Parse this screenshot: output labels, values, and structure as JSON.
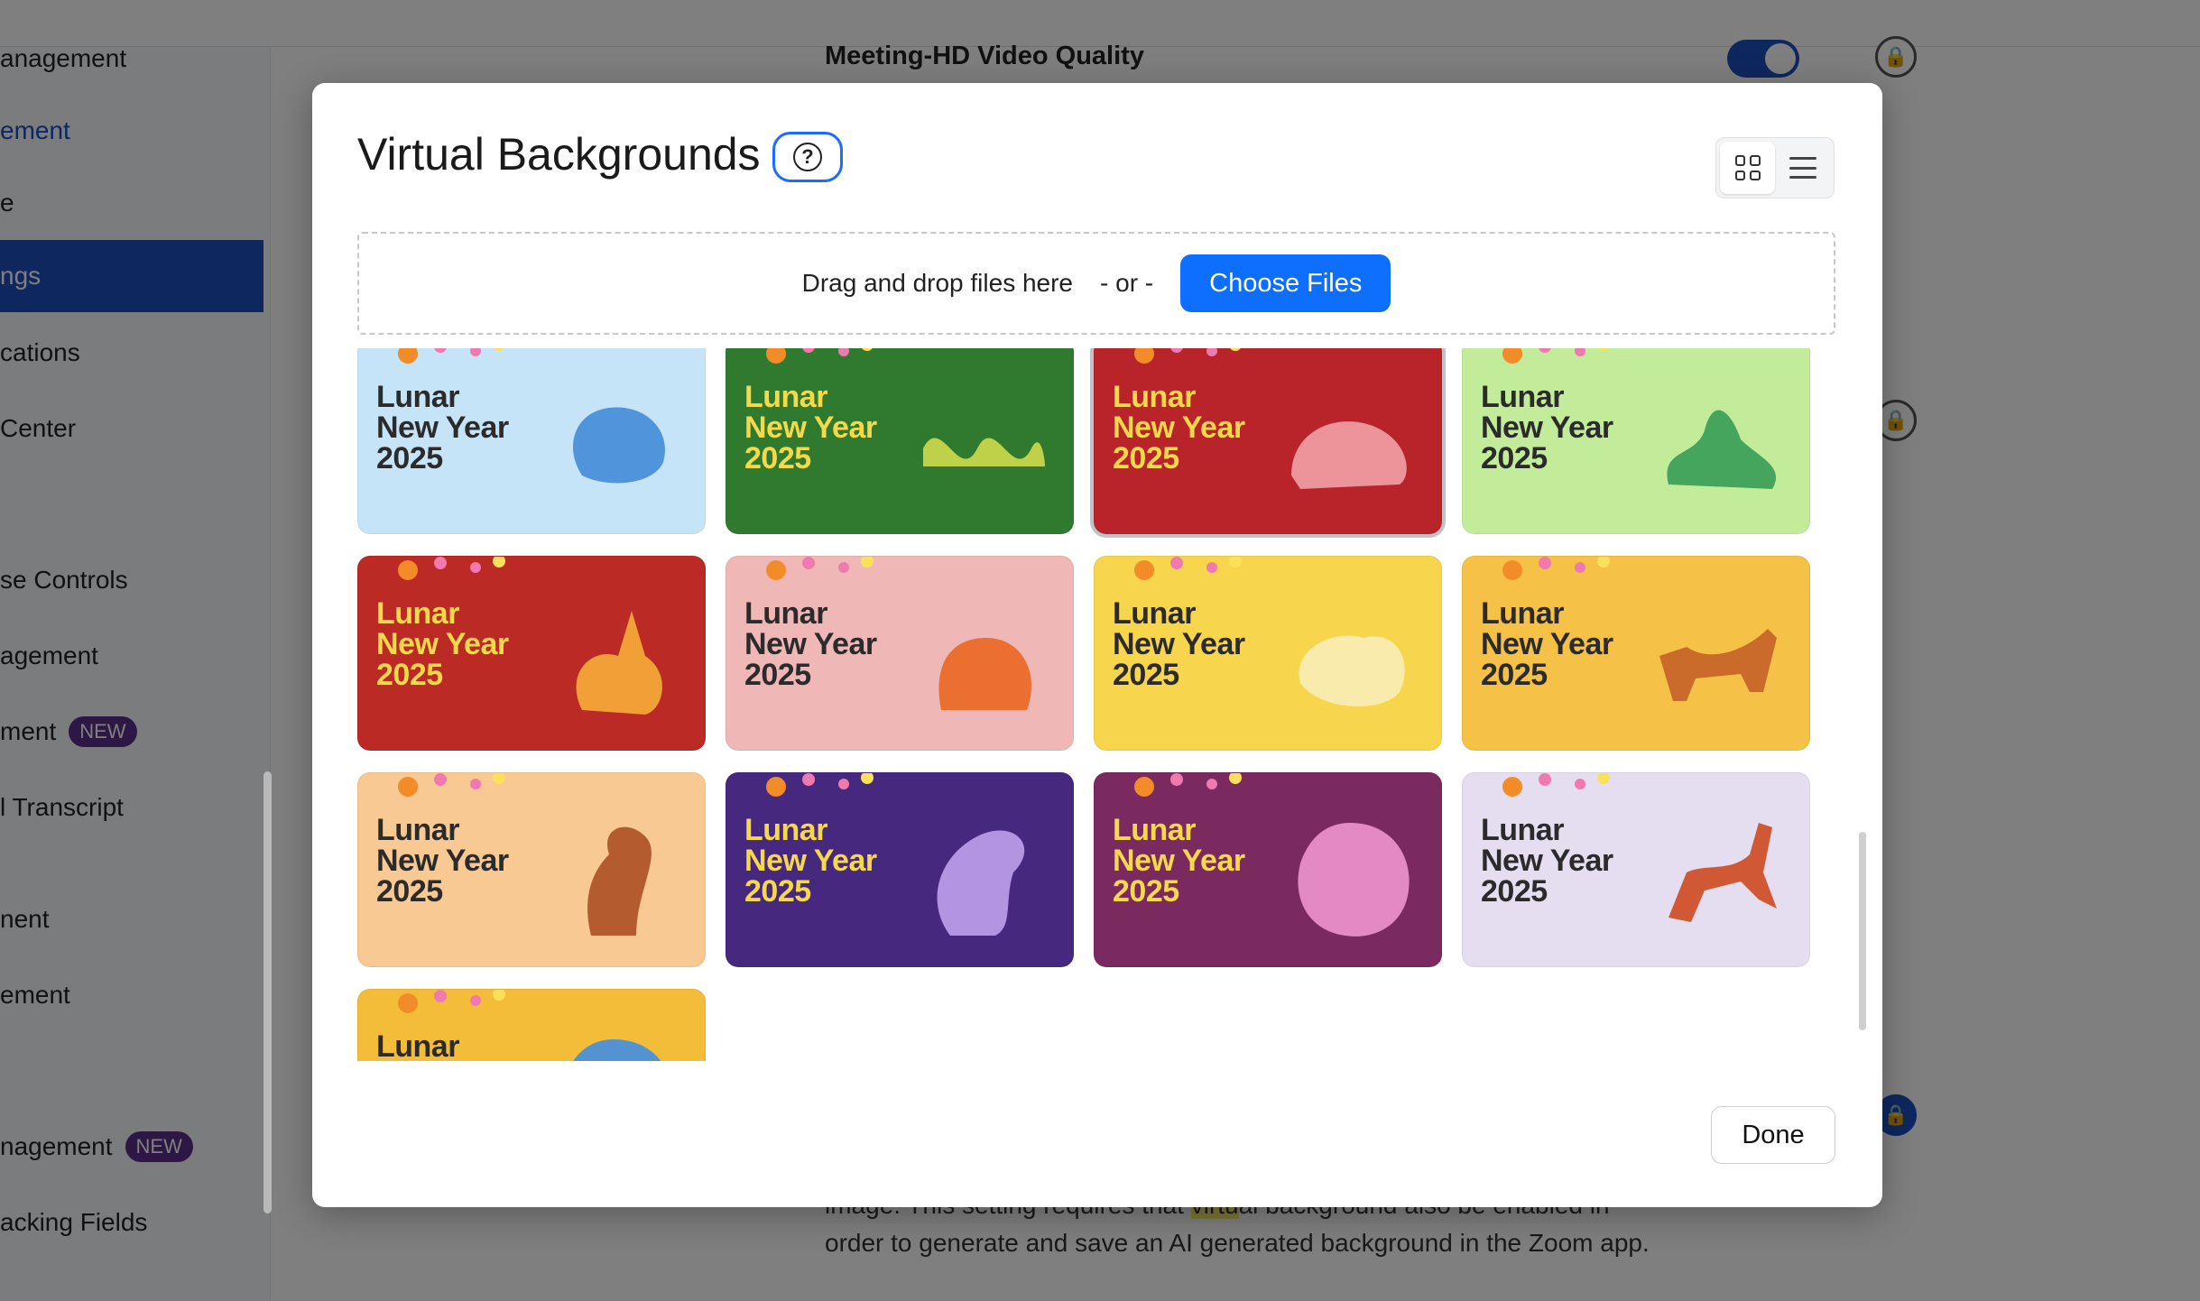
{
  "sidebar": {
    "items": [
      {
        "label": "anagement",
        "state": "normal"
      },
      {
        "label": "ement",
        "state": "link"
      },
      {
        "label": "e",
        "state": "normal"
      },
      {
        "label": "ngs",
        "state": "active"
      },
      {
        "label": "cations",
        "state": "normal"
      },
      {
        "label": "Center",
        "state": "normal"
      },
      {
        "label": "se Controls",
        "state": "normal"
      },
      {
        "label": "agement",
        "state": "normal"
      },
      {
        "label": "ment",
        "state": "normal",
        "badge": "NEW"
      },
      {
        "label": "l Transcript",
        "state": "normal"
      },
      {
        "label": "nent",
        "state": "normal"
      },
      {
        "label": "ement",
        "state": "normal"
      },
      {
        "label": "nagement",
        "state": "normal",
        "badge": "NEW"
      },
      {
        "label": "acking Fields",
        "state": "normal"
      }
    ]
  },
  "background": {
    "setting_title": "Meeting-HD Video Quality",
    "desc_line1_pre": "image. This setting requires that ",
    "desc_highlight": "virtu",
    "desc_line1_post": "al background also be enabled in",
    "desc_line2": "order to generate and save an AI generated background in the Zoom app.",
    "lock_glyph": "🔒"
  },
  "modal": {
    "title": "Virtual Backgrounds",
    "help_glyph": "?",
    "dropzone": {
      "text": "Drag and drop files here",
      "or": "- or -",
      "choose_label": "Choose Files"
    },
    "done_label": "Done",
    "thumb_text": {
      "line1": "Lunar",
      "line2": "New Year",
      "line3": "2025"
    },
    "thumbnails": [
      {
        "bg": "#c6e4f8",
        "text": "#2b2b2b",
        "animal": "rooster",
        "accent": "#4a90d9"
      },
      {
        "bg": "#2f7a2e",
        "text": "#f6d94a",
        "animal": "snake",
        "accent": "#c7d64a"
      },
      {
        "bg": "#b8242a",
        "text": "#f6d94a",
        "animal": "pig",
        "accent": "#ef9aa0"
      },
      {
        "bg": "#c2ec9a",
        "text": "#2b2b2b",
        "animal": "dragon",
        "accent": "#3ea15a"
      },
      {
        "bg": "#bb2a24",
        "text": "#f6d94a",
        "animal": "rabbit",
        "accent": "#f3a63a"
      },
      {
        "bg": "#efb8b6",
        "text": "#2b2b2b",
        "animal": "tiger",
        "accent": "#ea6a2a"
      },
      {
        "bg": "#f7d54d",
        "text": "#2b2b2b",
        "animal": "sheep",
        "accent": "#f8ecb0"
      },
      {
        "bg": "#f5c146",
        "text": "#2b2b2b",
        "animal": "dog",
        "accent": "#c7652a"
      },
      {
        "bg": "#f8c993",
        "text": "#2b2b2b",
        "animal": "monkey",
        "accent": "#b0562a"
      },
      {
        "bg": "#47287f",
        "text": "#f6d94a",
        "animal": "rat",
        "accent": "#b99ae8"
      },
      {
        "bg": "#7a2a5f",
        "text": "#f6d94a",
        "animal": "ox",
        "accent": "#e98fc8"
      },
      {
        "bg": "#e5def0",
        "text": "#2b2b2b",
        "animal": "horse",
        "accent": "#d0502a"
      },
      {
        "bg": "#f3bd3a",
        "text": "#2b2b2b",
        "animal": "ox",
        "accent": "#4a90d9"
      }
    ]
  }
}
